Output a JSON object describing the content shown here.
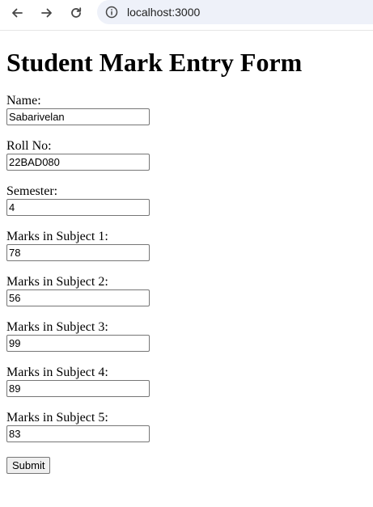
{
  "browser": {
    "url": "localhost:3000"
  },
  "form": {
    "title": "Student Mark Entry Form",
    "fields": [
      {
        "label": "Name:",
        "value": "Sabarivelan"
      },
      {
        "label": "Roll No:",
        "value": "22BAD080"
      },
      {
        "label": "Semester:",
        "value": "4"
      },
      {
        "label": "Marks in Subject 1:",
        "value": "78"
      },
      {
        "label": "Marks in Subject 2:",
        "value": "56"
      },
      {
        "label": "Marks in Subject 3:",
        "value": "99"
      },
      {
        "label": "Marks in Subject 4:",
        "value": "89"
      },
      {
        "label": "Marks in Subject 5:",
        "value": "83"
      }
    ],
    "submit_label": "Submit"
  }
}
